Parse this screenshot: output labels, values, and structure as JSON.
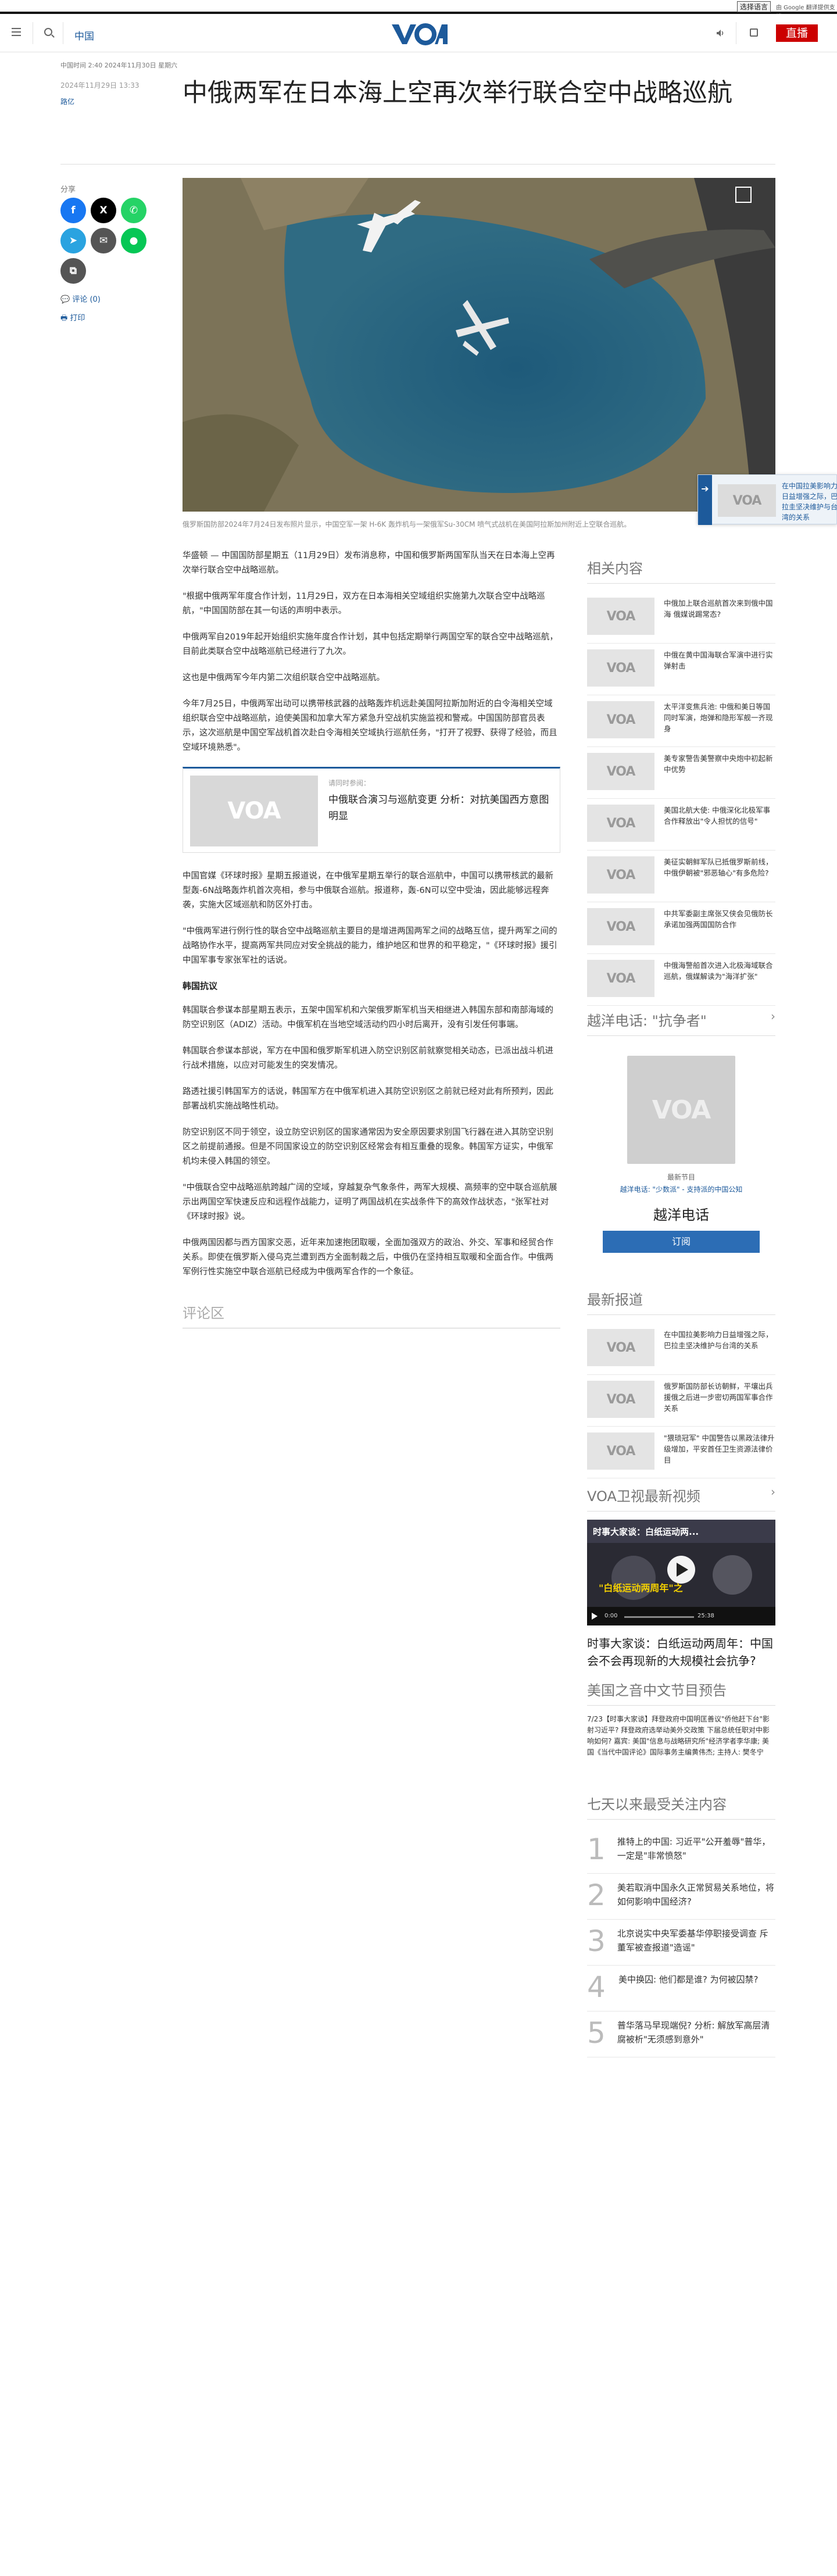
{
  "topbar": {
    "language_select": "选择语言",
    "translate_credit": "由 Google 翻译提供支持"
  },
  "header": {
    "section": "中国",
    "logo_text": "VOA",
    "live_label": "直播"
  },
  "article": {
    "meta_top": "中国时间 2:40 2024年11月30日 星期六",
    "date": "2024年11月29日 13:33",
    "author": "路亿",
    "headline": "中俄两军在日本海上空再次举行联合空中战略巡航",
    "share_label": "分享",
    "comments_link": "评论 (0)",
    "print_link": "打印",
    "image_caption": "俄罗斯国防部2024年7月24日发布照片显示，中国空军一架 H-6K 轰炸机与一架俄军Su-30CM 喷气式战机在美国阿拉斯加州附近上空联合巡航。",
    "paragraphs": [
      "华盛顿 — 中国国防部星期五（11月29日）发布消息称，中国和俄罗斯两国军队当天在日本海上空再次举行联合空中战略巡航。",
      "\"根据中俄两军年度合作计划，11月29日，双方在日本海相关空域组织实施第九次联合空中战略巡航，\"中国国防部在其一句话的声明中表示。",
      "中俄两军自2019年起开始组织实施年度合作计划，其中包括定期举行两国空军的联合空中战略巡航，目前此类联合空中战略巡航已经进行了九次。",
      "这也是中俄两军今年内第二次组织联合空中战略巡航。",
      "今年7月25日，中俄两军出动可以携带核武器的战略轰炸机远赴美国阿拉斯加附近的白令海相关空域组织联合空中战略巡航，迫使美国和加拿大军方紧急升空战机实施监视和警戒。中国国防部官员表示，这次巡航是中国空军战机首次赴白令海相关空域执行巡航任务，\"打开了视野、获得了经验，而且空域环境熟悉\"。"
    ],
    "related_card": {
      "label": "请同时参阅：",
      "title": "中俄联合演习与巡航变更 分析：对抗美国西方意图明显"
    },
    "paragraphs2": [
      "中国官媒《环球时报》星期五报道说，在中俄军星期五举行的联合巡航中，中国可以携带核武的最新型轰-6N战略轰炸机首次亮相，参与中俄联合巡航。报道称，轰-6N可以空中受油，因此能够远程奔袭，实施大区域巡航和防区外打击。",
      "\"中俄两军进行例行性的联合空中战略巡航主要目的是增进两国两军之间的战略互信，提升两军之间的战略协作水平，提高两军共同应对安全挑战的能力，维护地区和世界的和平稳定，\"《环球时报》援引中国军事专家张军社的话说。"
    ],
    "subheading": "韩国抗议",
    "paragraphs3": [
      "韩国联合参谋本部星期五表示，五架中国军机和六架俄罗斯军机当天相继进入韩国东部和南部海域的防空识别区（ADIZ）活动。中俄军机在当地空域活动约四小时后离开，没有引发任何事端。",
      "韩国联合参谋本部说，军方在中国和俄罗斯军机进入防空识别区前就察觉相关动态，已派出战斗机进行战术措施，以应对可能发生的突发情况。",
      "路透社援引韩国军方的话说，韩国军方在中俄军机进入其防空识别区之前就已经对此有所预判，因此部署战机实施战略性机动。",
      "防空识别区不同于领空，设立防空识别区的国家通常因为安全原因要求别国飞行器在进入其防空识别区之前提前通报。但是不同国家设立的防空识别区经常会有相互重叠的现象。韩国军方证实，中俄军机均未侵入韩国的领空。",
      "\"中俄联合空中战略巡航跨越广阔的空域，穿越复杂气象条件，两军大规模、高频率的空中联合巡航展示出两国空军快速反应和远程作战能力，证明了两国战机在实战条件下的高效作战状态，\"张军社对《环球时报》说。",
      "中俄两国因都与西方国家交恶，近年来加速抱团取暖，全面加强双方的政治、外交、军事和经贸合作关系。即使在俄罗斯入侵乌克兰遭到西方全面制裁之后，中俄仍在坚持相互取暖和全面合作。中俄两军例行性实施空中联合巡航已经成为中俄两军合作的一个象征。"
    ],
    "comments_area": "评论区"
  },
  "rail": {
    "related_title": "相关内容",
    "related_items": [
      "中俄加上联合巡航首次来到俄中国海 俄媒说踢常态?",
      "中俄在黄中国海联合军演中进行实弹射击",
      "太平洋变焦兵池: 中俄和美日等国同时军演，炮弹和隐形军舰一齐现身",
      "美专家警告美警察中央炮中初起新中优势",
      "美国北航大使: 中俄深化北极军事合作释放出\"令人担忧的信号\"",
      "美征实朝鲜军队已抵俄罗斯前线，中俄伊朝被\"邪恶轴心\"有多危险?",
      "中共军委副主席张又侠会见俄防长 承诺加强两国国防合作",
      "中俄海警船首次进入北极海域联合巡航，俄媒解读为\"海洋扩张\""
    ],
    "radio_section": "越洋电话: \"抗争者\"",
    "radio_small": "最新节目",
    "radio_sub": "越洋电话: \"少数派\" - 支持派的中国公知",
    "radio_name": "越洋电话",
    "radio_button": "订阅",
    "latest_title": "最新报道",
    "latest_items": [
      "在中国拉美影响力日益增强之际，巴拉圭坚决维护与台湾的关系",
      "俄罗斯国防部长访朝鲜，平壤出兵援俄之后进一步密切两国军事合作关系",
      "\"猥琐冠军\" 中国警告以黑政法律升级增加，平安首任卫生资源法律价目"
    ],
    "video_section": "VOA卫视最新视频",
    "video_overlay_title": "时事大家谈：白纸运动两...",
    "video_caption": "\"白纸运动两周年\"之",
    "video_time_current": "0:00",
    "video_time_total": "25:38",
    "video_title": "时事大家谈：白纸运动两周年：中国会不会再现新的大规模社会抗争?",
    "preview_section": "美国之音中文节目预告",
    "preview_text": "7/23【时事大家谈】拜登政府中国明匡善议\"侨他赶下台\"影射习近平? 拜登政府选举动美外交政策 下届总统任职对中影响如何? 嘉宾: 美国\"信息与战略研究所\"经济学者李华康; 美国《当代中国评论》国际事务主编黄伟杰; 主持人: 樊冬宁",
    "top_section": "七天以来最受关注内容",
    "top_items": [
      "推特上的中国: 习近平\"公开羞辱\"普华，一定是\"非常愤怒\"",
      "美若取消中国永久正常贸易关系地位，将如何影响中国经济?",
      "北京说实中央军委基华停职接受调查 斥董军被查报道\"造谣\"",
      "美中换囚: 他们都是谁? 为何被囚禁?",
      "普华落马早现端倪? 分析: 解放军高层清腐被析\"无须感到意外\""
    ]
  },
  "teaser": {
    "text": "在中国拉美影响力日益增强之际，巴拉圭坚决维护与台湾的关系"
  },
  "colors": {
    "brand_blue": "#1d5a9b",
    "live_red": "#cc0000"
  }
}
